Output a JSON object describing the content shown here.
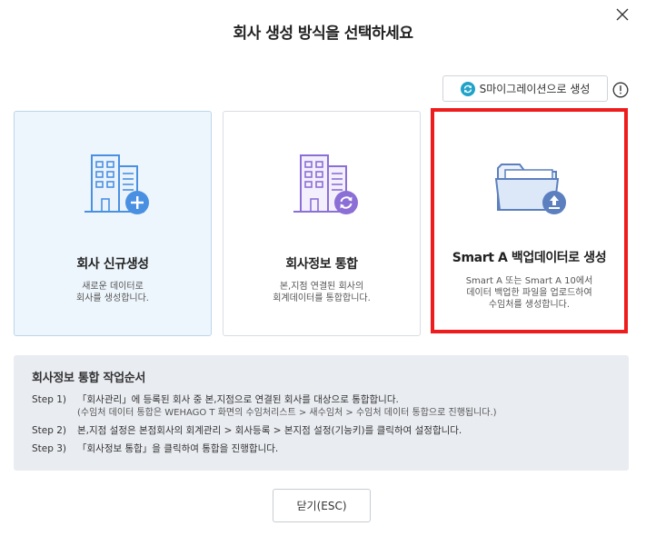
{
  "dialog": {
    "title": "회사 생성 방식을 선택하세요"
  },
  "migration": {
    "label": "S마이그레이션으로 생성",
    "icon": "refresh-icon"
  },
  "cards": [
    {
      "title": "회사 신규생성",
      "desc": [
        "새로운 데이터로",
        "회사를 생성합니다."
      ],
      "icon": "building-add-icon"
    },
    {
      "title": "회사정보 통합",
      "desc": [
        "본,지점 연결된 회사의",
        "회계데이터를 통합합니다."
      ],
      "icon": "building-merge-icon"
    },
    {
      "title": "Smart A 백업데이터로 생성",
      "desc": [
        "Smart A 또는 Smart A 10에서",
        "데이터 백업한 파일을 업로드하여",
        "수임처를 생성합니다."
      ],
      "icon": "folder-upload-icon"
    }
  ],
  "guide": {
    "title": "회사정보 통합 작업순서",
    "steps": [
      {
        "label": "Step 1)",
        "text": "「회사관리」에 등록된 회사 중 본,지점으로 연결된 회사를 대상으로 통합합니다.",
        "sub": "(수임처 데이터 통합은 WEHAGO T 화면의 수임처리스트 > 새수임처 > 수임처 데이터 통합으로 진행됩니다.)"
      },
      {
        "label": "Step 2)",
        "text": "본,지점 설정은 본점회사의 회계관리 > 회사등록 > 본지점 설정(기능키)를 클릭하여 설정합니다."
      },
      {
        "label": "Step 3)",
        "text": "「회사정보 통합」을 클릭하여 통합을 진행합니다."
      }
    ]
  },
  "footer": {
    "close_label": "닫기(ESC)"
  },
  "colors": {
    "accent_blue": "#4a90e2",
    "accent_purple": "#8b6fd6",
    "selected_border": "#ee1c1c"
  }
}
